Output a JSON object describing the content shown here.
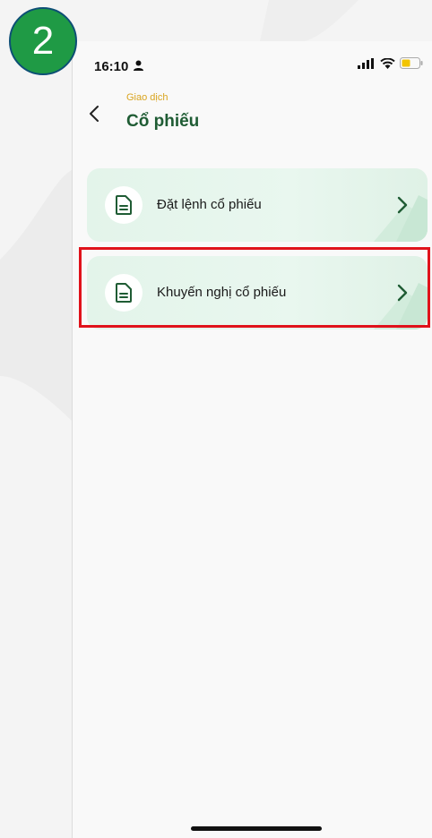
{
  "step_badge": {
    "number": "2"
  },
  "status_bar": {
    "time": "16:10"
  },
  "header": {
    "breadcrumb": "Giao dịch",
    "title": "Cổ phiếu"
  },
  "menu": {
    "items": [
      {
        "label": "Đặt lệnh cổ phiếu",
        "icon": "document-icon"
      },
      {
        "label": "Khuyến nghị cổ phiếu",
        "icon": "document-icon",
        "highlighted": true
      }
    ]
  },
  "colors": {
    "accent_green": "#1f5c34",
    "badge_green": "#1f9a45",
    "breadcrumb_gold": "#d9a520",
    "highlight_red": "#e0121b",
    "card_bg": "#e3f4ea"
  }
}
